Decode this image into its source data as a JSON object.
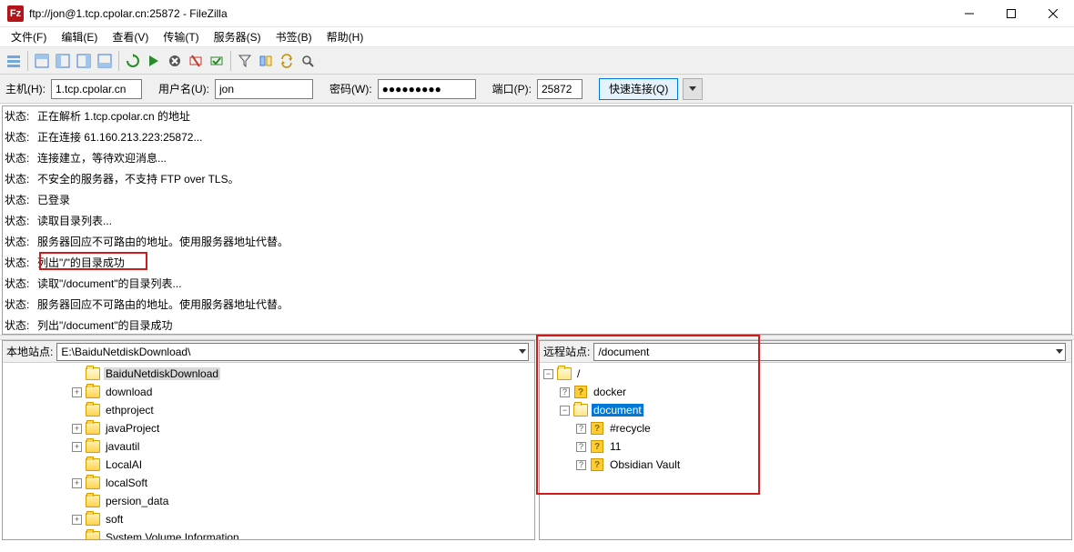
{
  "window": {
    "title": "ftp://jon@1.tcp.cpolar.cn:25872 - FileZilla",
    "app_icon_text": "Fz"
  },
  "menu": {
    "file": "文件(F)",
    "edit": "编辑(E)",
    "view": "查看(V)",
    "transfer": "传输(T)",
    "server": "服务器(S)",
    "bookmarks": "书签(B)",
    "help": "帮助(H)"
  },
  "quickconnect": {
    "host_label": "主机(H):",
    "host_value": "1.tcp.cpolar.cn",
    "user_label": "用户名(U):",
    "user_value": "jon",
    "pass_label": "密码(W):",
    "pass_value": "●●●●●●●●●",
    "port_label": "端口(P):",
    "port_value": "25872",
    "connect_btn": "快速连接(Q)"
  },
  "log": {
    "label": "状态:",
    "lines": [
      "正在解析 1.tcp.cpolar.cn 的地址",
      "正在连接 61.160.213.223:25872...",
      "连接建立，等待欢迎消息...",
      "不安全的服务器，不支持 FTP over TLS。",
      "已登录",
      "读取目录列表...",
      "服务器回应不可路由的地址。使用服务器地址代替。",
      "列出\"/\"的目录成功",
      "读取\"/document\"的目录列表...",
      "服务器回应不可路由的地址。使用服务器地址代替。",
      "列出\"/document\"的目录成功"
    ]
  },
  "local": {
    "label": "本地站点:",
    "path": "E:\\BaiduNetdiskDownload\\",
    "items": [
      {
        "indent": 4,
        "exp": "",
        "name": "BaiduNetdiskDownload",
        "sel": "gray",
        "icon": "open"
      },
      {
        "indent": 4,
        "exp": "+",
        "name": "download",
        "icon": "closed"
      },
      {
        "indent": 4,
        "exp": "",
        "name": "ethproject",
        "icon": "closed"
      },
      {
        "indent": 4,
        "exp": "+",
        "name": "javaProject",
        "icon": "closed"
      },
      {
        "indent": 4,
        "exp": "+",
        "name": "javautil",
        "icon": "closed"
      },
      {
        "indent": 4,
        "exp": "",
        "name": "LocalAI",
        "icon": "closed"
      },
      {
        "indent": 4,
        "exp": "+",
        "name": "localSoft",
        "icon": "closed"
      },
      {
        "indent": 4,
        "exp": "",
        "name": "persion_data",
        "icon": "closed"
      },
      {
        "indent": 4,
        "exp": "+",
        "name": "soft",
        "icon": "closed"
      },
      {
        "indent": 4,
        "exp": "",
        "name": "System Volume Information",
        "icon": "closed"
      }
    ]
  },
  "remote": {
    "label": "远程站点:",
    "path": "/document",
    "items": [
      {
        "indent": 0,
        "exp": "-",
        "name": "/",
        "icon": "open"
      },
      {
        "indent": 1,
        "exp": "?",
        "name": "docker",
        "icon": "q"
      },
      {
        "indent": 1,
        "exp": "-",
        "name": "document",
        "sel": "blue",
        "icon": "open"
      },
      {
        "indent": 2,
        "exp": "?",
        "name": "#recycle",
        "icon": "q"
      },
      {
        "indent": 2,
        "exp": "?",
        "name": "11",
        "icon": "q"
      },
      {
        "indent": 2,
        "exp": "?",
        "name": "Obsidian Vault",
        "icon": "q"
      }
    ]
  }
}
